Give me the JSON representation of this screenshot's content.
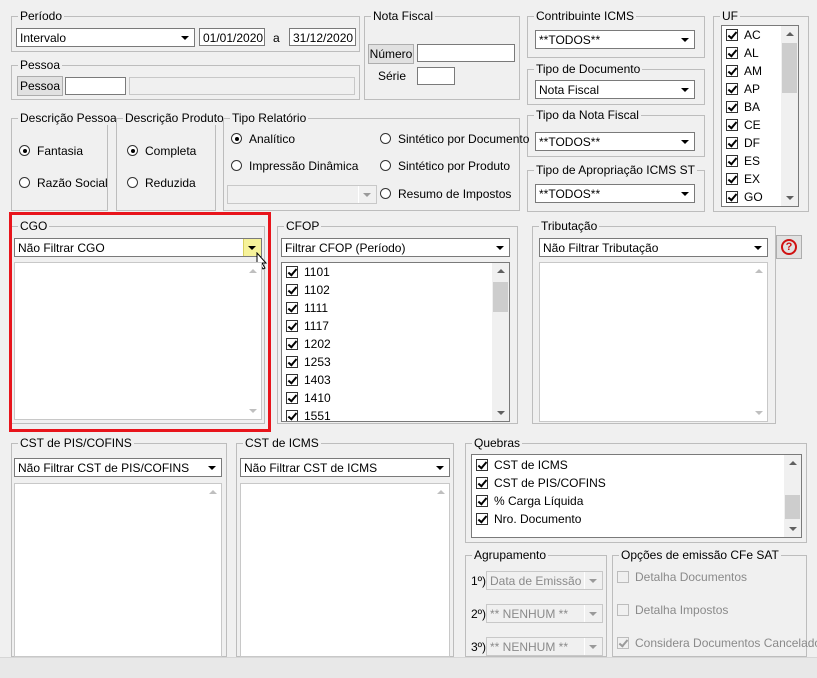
{
  "periodo": {
    "label": "Período",
    "type": "Intervalo",
    "start": "01/01/2020",
    "sep": "a",
    "end": "31/12/2020"
  },
  "nota_fiscal": {
    "label": "Nota Fiscal",
    "numero_button": "Número",
    "numero_value": "",
    "serie_label": "Série",
    "serie_value": ""
  },
  "pessoa": {
    "label": "Pessoa",
    "button": "Pessoa",
    "code": "",
    "name": ""
  },
  "contribuinte": {
    "label": "Contribuinte ICMS",
    "value": "**TODOS**"
  },
  "tipo_documento": {
    "label": "Tipo de Documento",
    "value": "Nota Fiscal"
  },
  "tipo_nota": {
    "label": "Tipo da Nota Fiscal",
    "value": "**TODOS**"
  },
  "tipo_apropriacao": {
    "label": "Tipo de Apropriação ICMS ST",
    "value": "**TODOS**"
  },
  "uf": {
    "label": "UF",
    "items": [
      "AC",
      "AL",
      "AM",
      "AP",
      "BA",
      "CE",
      "DF",
      "ES",
      "EX",
      "GO"
    ]
  },
  "descricao_pessoa": {
    "label": "Descrição Pessoa",
    "opt1": "Fantasia",
    "opt2": "Razão Social"
  },
  "descricao_produto": {
    "label": "Descrição Produto",
    "opt1": "Completa",
    "opt2": "Reduzida"
  },
  "tipo_relatorio": {
    "label": "Tipo Relatório",
    "analitico": "Analítico",
    "impressao": "Impressão Dinâmica",
    "sint_doc": "Sintético por Documento",
    "sint_prod": "Sintético por Produto",
    "resumo": "Resumo de Impostos",
    "combo_value": ""
  },
  "cgo": {
    "label": "CGO",
    "value": "Não Filtrar CGO"
  },
  "cfop": {
    "label": "CFOP",
    "value": "Filtrar CFOP (Período)",
    "items": [
      "1101",
      "1102",
      "1111",
      "1117",
      "1202",
      "1253",
      "1403",
      "1410",
      "1551"
    ]
  },
  "tributacao": {
    "label": "Tributação",
    "value": "Não Filtrar Tributação",
    "help": "?"
  },
  "cst_pis": {
    "label": "CST de PIS/COFINS",
    "value": "Não Filtrar CST de PIS/COFINS"
  },
  "cst_icms": {
    "label": "CST de ICMS",
    "value": "Não Filtrar CST de ICMS"
  },
  "quebras": {
    "label": "Quebras",
    "items": [
      "CST de ICMS",
      "CST de PIS/COFINS",
      "% Carga Líquida",
      "Nro. Documento"
    ]
  },
  "agrupamento": {
    "label": "Agrupamento",
    "l1": "1º)",
    "v1": "Data de Emissão",
    "l2": "2º)",
    "v2": "** NENHUM **",
    "l3": "3º)",
    "v3": "** NENHUM **"
  },
  "opcoes_cfe": {
    "label": "Opções de emissão CFe SAT",
    "o1": "Detalha Documentos",
    "o2": "Detalha Impostos",
    "o3": "Considera Documentos Cancelados"
  },
  "highlight_color": "#e8141b"
}
